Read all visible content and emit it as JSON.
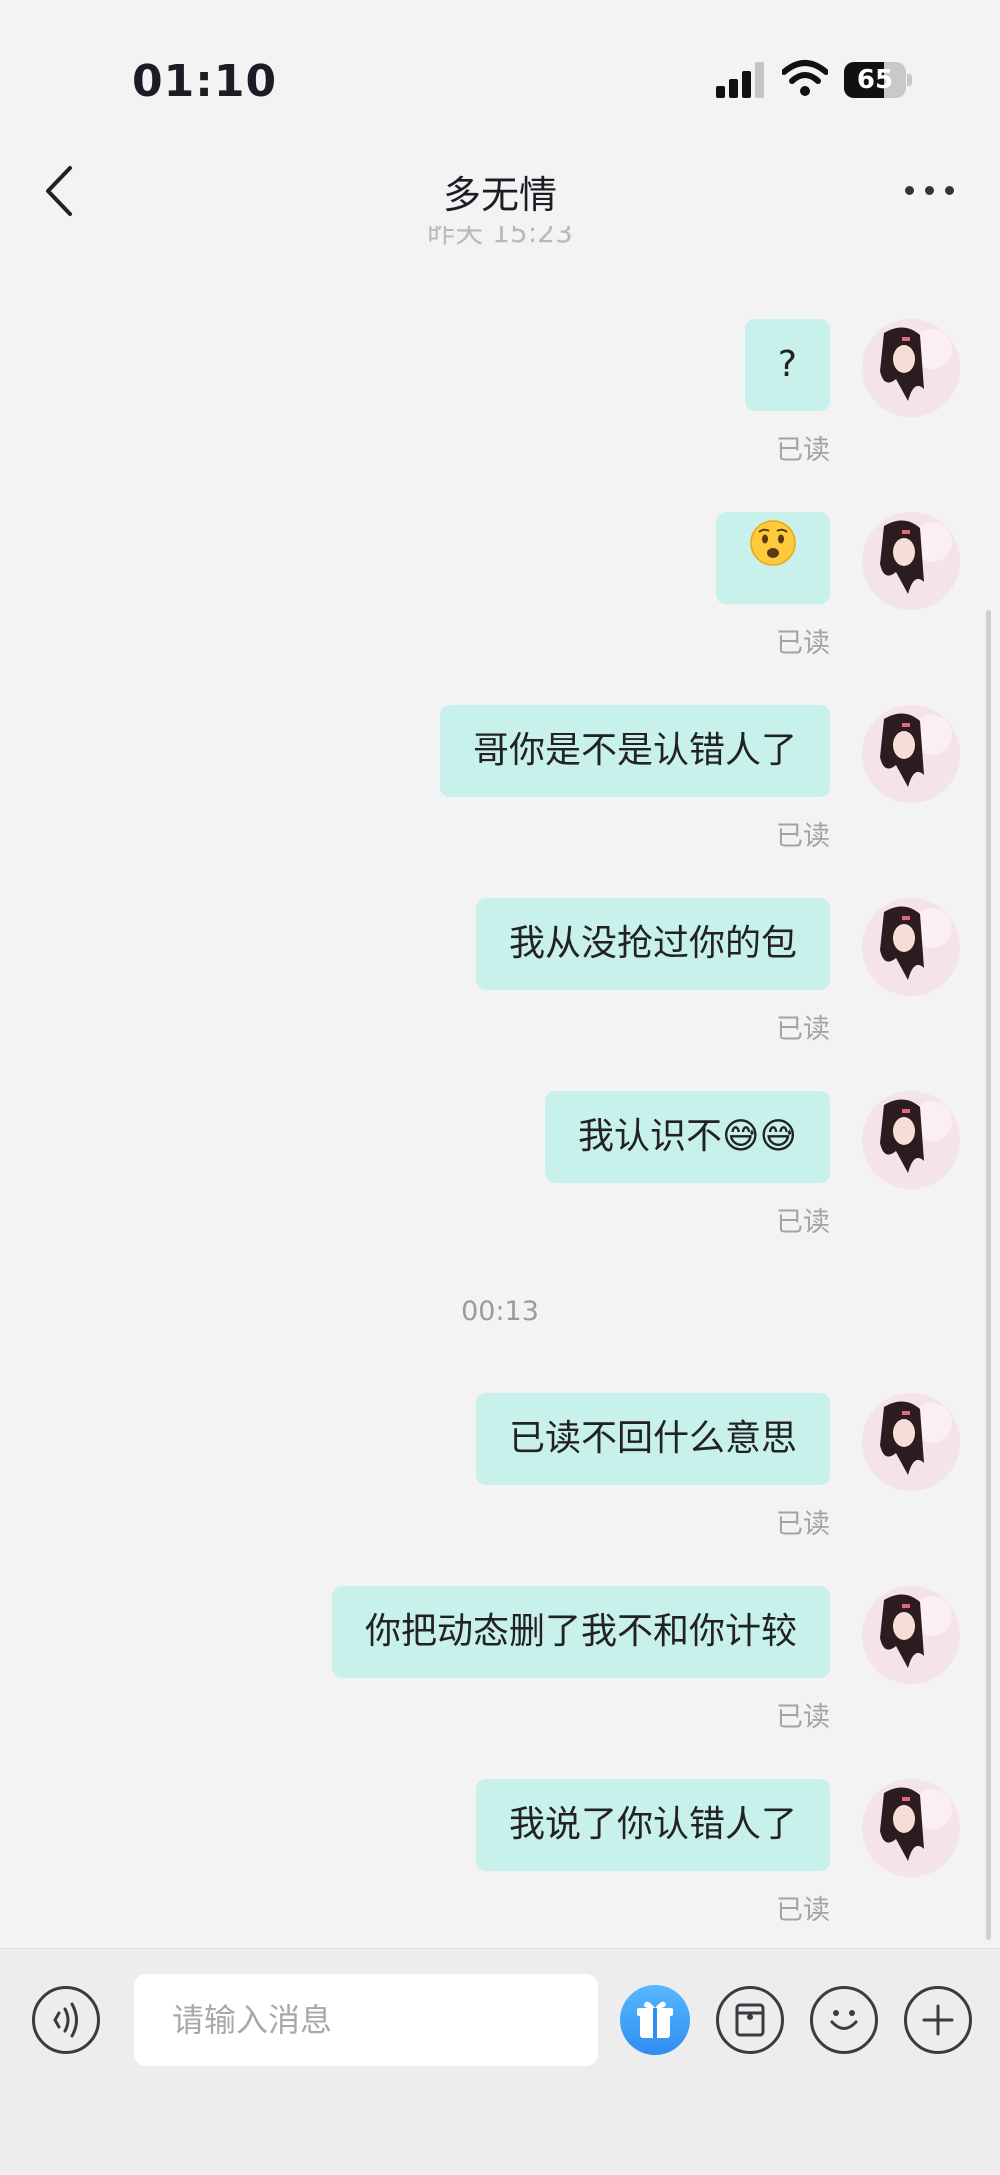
{
  "status_bar": {
    "time": "01:10",
    "battery": "65",
    "battery_level": 0.65
  },
  "header": {
    "title": "多无情"
  },
  "earlier_timestamp": "昨天 15:23",
  "messages_group1": [
    {
      "text": "?",
      "status": "已读"
    },
    {
      "emoji": "😧",
      "status": "已读"
    },
    {
      "text": "哥你是不是认错人了",
      "status": "已读"
    },
    {
      "text": "我从没抢过你的包",
      "status": "已读"
    },
    {
      "text": "我认识不😅😅",
      "status": "已读"
    }
  ],
  "timestamp": "00:13",
  "messages_group2": [
    {
      "text": "已读不回什么意思",
      "status": "已读"
    },
    {
      "text": "你把动态删了我不和你计较",
      "status": "已读"
    },
    {
      "text": "我说了你认错人了",
      "status": "已读"
    }
  ],
  "input": {
    "placeholder": "请输入消息"
  },
  "icons": {
    "voice": "voice-icon",
    "gift": "gift-icon",
    "sticker": "sticker-pack-icon",
    "emoji": "emoji-icon",
    "add": "plus-icon"
  },
  "colors": {
    "bubble": "#c9f1ec",
    "gift": "#2f8df0"
  }
}
